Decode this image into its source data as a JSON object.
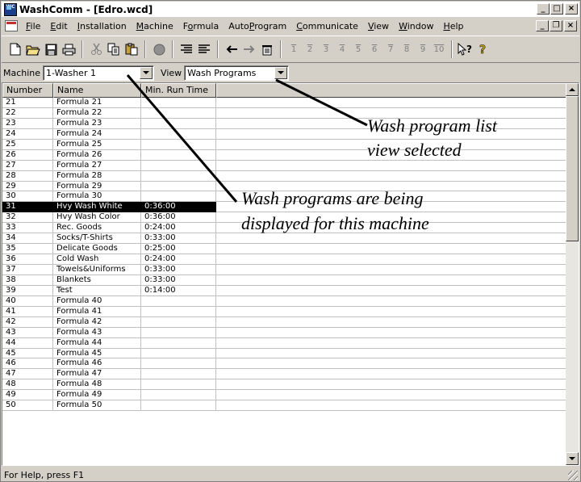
{
  "window": {
    "title": "WashComm - [Edro.wcd]",
    "app_icon_text": "WC"
  },
  "menu": {
    "items": [
      {
        "label": "File",
        "ul": "F",
        "rest": "ile"
      },
      {
        "label": "Edit",
        "ul": "E",
        "rest": "dit"
      },
      {
        "label": "Installation",
        "ul": "I",
        "rest": "nstallation"
      },
      {
        "label": "Machine",
        "ul": "M",
        "rest": "achine"
      },
      {
        "label": "Formula",
        "pre": "F",
        "ul": "o",
        "rest": "rmula"
      },
      {
        "label": "AutoProgram",
        "pre": "Auto",
        "ul": "P",
        "rest": "rogram"
      },
      {
        "label": "Communicate",
        "ul": "C",
        "rest": "ommunicate"
      },
      {
        "label": "View",
        "ul": "V",
        "rest": "iew"
      },
      {
        "label": "Window",
        "ul": "W",
        "rest": "indow"
      },
      {
        "label": "Help",
        "ul": "H",
        "rest": "elp"
      }
    ]
  },
  "toolbar": {
    "number_buttons": [
      "1",
      "2",
      "3",
      "4",
      "5",
      "6",
      "7",
      "8",
      "9",
      "10"
    ]
  },
  "selectors": {
    "machine_label": "Machine",
    "machine_value": "1-Washer 1",
    "view_label": "View",
    "view_value": "Wash Programs"
  },
  "list": {
    "columns": [
      "Number",
      "Name",
      "Min. Run Time"
    ],
    "selected_number": "31",
    "rows": [
      {
        "number": "21",
        "name": "Formula 21",
        "time": ""
      },
      {
        "number": "22",
        "name": "Formula 22",
        "time": ""
      },
      {
        "number": "23",
        "name": "Formula 23",
        "time": ""
      },
      {
        "number": "24",
        "name": "Formula 24",
        "time": ""
      },
      {
        "number": "25",
        "name": "Formula 25",
        "time": ""
      },
      {
        "number": "26",
        "name": "Formula 26",
        "time": ""
      },
      {
        "number": "27",
        "name": "Formula 27",
        "time": ""
      },
      {
        "number": "28",
        "name": "Formula 28",
        "time": ""
      },
      {
        "number": "29",
        "name": "Formula 29",
        "time": ""
      },
      {
        "number": "30",
        "name": "Formula 30",
        "time": ""
      },
      {
        "number": "31",
        "name": "Hvy Wash White",
        "time": "0:36:00"
      },
      {
        "number": "32",
        "name": "Hvy Wash Color",
        "time": "0:36:00"
      },
      {
        "number": "33",
        "name": "Rec. Goods",
        "time": "0:24:00"
      },
      {
        "number": "34",
        "name": "Socks/T-Shirts",
        "time": "0:33:00"
      },
      {
        "number": "35",
        "name": "Delicate Goods",
        "time": "0:25:00"
      },
      {
        "number": "36",
        "name": "Cold Wash",
        "time": "0:24:00"
      },
      {
        "number": "37",
        "name": "Towels&Uniforms",
        "time": "0:33:00"
      },
      {
        "number": "38",
        "name": "Blankets",
        "time": "0:33:00"
      },
      {
        "number": "39",
        "name": "Test",
        "time": "0:14:00"
      },
      {
        "number": "40",
        "name": "Formula 40",
        "time": ""
      },
      {
        "number": "41",
        "name": "Formula 41",
        "time": ""
      },
      {
        "number": "42",
        "name": "Formula 42",
        "time": ""
      },
      {
        "number": "43",
        "name": "Formula 43",
        "time": ""
      },
      {
        "number": "44",
        "name": "Formula 44",
        "time": ""
      },
      {
        "number": "45",
        "name": "Formula 45",
        "time": ""
      },
      {
        "number": "46",
        "name": "Formula 46",
        "time": ""
      },
      {
        "number": "47",
        "name": "Formula 47",
        "time": ""
      },
      {
        "number": "48",
        "name": "Formula 48",
        "time": ""
      },
      {
        "number": "49",
        "name": "Formula 49",
        "time": ""
      },
      {
        "number": "50",
        "name": "Formula 50",
        "time": ""
      }
    ]
  },
  "status": {
    "text": "For Help, press F1"
  },
  "annotations": {
    "view_note_line1": "Wash program list",
    "view_note_line2": "view selected",
    "machine_note_line1": "Wash programs are being",
    "machine_note_line2": "displayed for this machine"
  }
}
